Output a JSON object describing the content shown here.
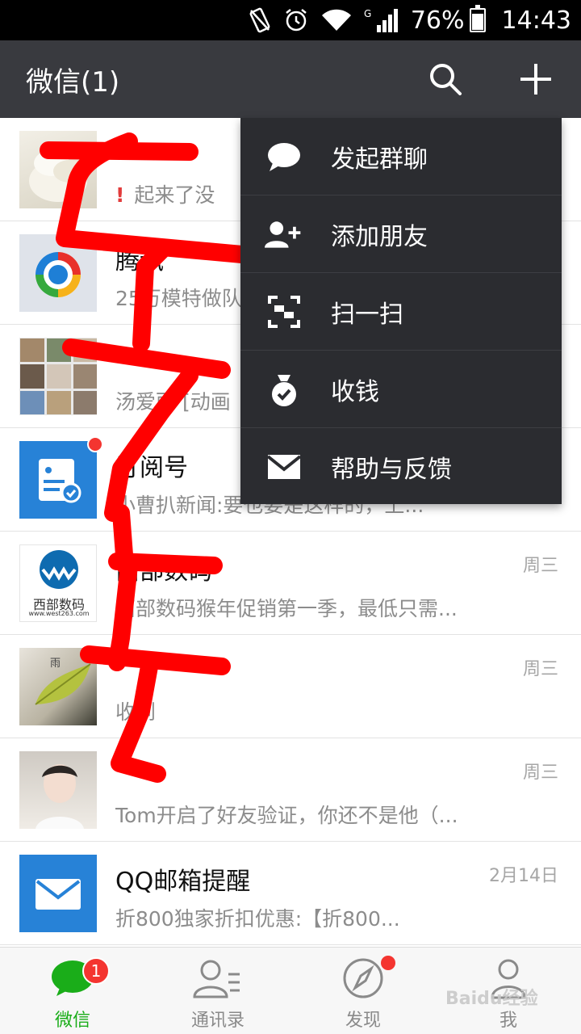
{
  "status_bar": {
    "battery": "76%",
    "time": "14:43",
    "network": "G"
  },
  "header": {
    "title": "微信(1)"
  },
  "chats": [
    {
      "name": "",
      "preview": "起来了没",
      "time": "",
      "alert": true
    },
    {
      "name": "腾讯",
      "preview": "25万模特做队",
      "time": ""
    },
    {
      "name": "",
      "preview": "汤爱丽 [动画",
      "time": ""
    },
    {
      "name": "订阅号",
      "preview": "小曹扒新闻:要也要是这样的，上...",
      "time": "",
      "unread_dot": true
    },
    {
      "name": "西部数码",
      "preview": "西部数码猴年促销第一季，最低只需...",
      "time": "周三",
      "avatar_text": "西部数码",
      "avatar_subtext": "www.west263.com"
    },
    {
      "name": "",
      "preview": "收到",
      "time": "周三",
      "avatar_text": "雨"
    },
    {
      "name": "",
      "preview": "Tom开启了好友验证，你还不是他（...",
      "time": "周三"
    },
    {
      "name": "QQ邮箱提醒",
      "preview": "折800独家折扣优惠:【折800...",
      "time": "2月14日"
    }
  ],
  "menu": {
    "items": [
      {
        "label": "发起群聊",
        "icon": "chat-bubble-icon"
      },
      {
        "label": "添加朋友",
        "icon": "add-friend-icon"
      },
      {
        "label": "扫一扫",
        "icon": "scan-icon"
      },
      {
        "label": "收钱",
        "icon": "money-bag-icon"
      },
      {
        "label": "帮助与反馈",
        "icon": "envelope-icon"
      }
    ]
  },
  "tabs": [
    {
      "label": "微信",
      "badge": "1",
      "active": true
    },
    {
      "label": "通讯录"
    },
    {
      "label": "发现",
      "dot": true
    },
    {
      "label": "我"
    }
  ],
  "watermark": "Baidu经验",
  "colors": {
    "header": "#393a3f",
    "active_tab": "#1aad19",
    "badge": "#f43530",
    "menu": "#2b2c30",
    "scribble": "#ff0000"
  }
}
